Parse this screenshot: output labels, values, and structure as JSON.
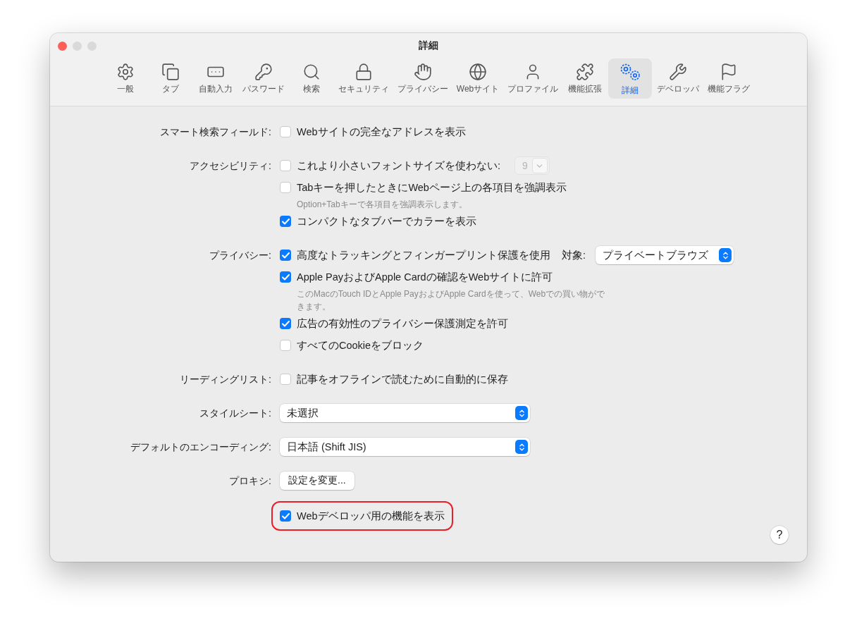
{
  "window": {
    "title": "詳細"
  },
  "tabs": [
    {
      "label": "一般",
      "selected": false
    },
    {
      "label": "タブ",
      "selected": false
    },
    {
      "label": "自動入力",
      "selected": false
    },
    {
      "label": "パスワード",
      "selected": false
    },
    {
      "label": "検索",
      "selected": false
    },
    {
      "label": "セキュリティ",
      "selected": false
    },
    {
      "label": "プライバシー",
      "selected": false
    },
    {
      "label": "Webサイト",
      "selected": false
    },
    {
      "label": "プロファイル",
      "selected": false
    },
    {
      "label": "機能拡張",
      "selected": false
    },
    {
      "label": "詳細",
      "selected": true
    },
    {
      "label": "デベロッパ",
      "selected": false
    },
    {
      "label": "機能フラグ",
      "selected": false
    }
  ],
  "sections": [
    {
      "label": "スマート検索フィールド:",
      "items": [
        {
          "kind": "checkbox",
          "label": "Webサイトの完全なアドレスを表示",
          "checked": false
        }
      ]
    },
    {
      "label": "アクセシビリティ:",
      "items": [
        {
          "kind": "checkbox",
          "label": "これより小さいフォントサイズを使わない:",
          "checked": false,
          "stepper": {
            "value": "9",
            "disabled": true
          }
        },
        {
          "kind": "checkbox",
          "label": "Tabキーを押したときにWebページ上の各項目を強調表示",
          "checked": false
        },
        {
          "kind": "note",
          "text": "Option+Tabキーで各項目を強調表示します。"
        },
        {
          "kind": "checkbox",
          "label": "コンパクトなタブバーでカラーを表示",
          "checked": true
        }
      ]
    },
    {
      "label": "プライバシー:",
      "items": [
        {
          "kind": "checkbox",
          "label": "高度なトラッキングとフィンガープリント保護を使用",
          "checked": true,
          "popup": {
            "label": "対象:",
            "value": "プライベートブラウズ"
          }
        },
        {
          "kind": "checkbox",
          "label": "Apple PayおよびApple Cardの確認をWebサイトに許可",
          "checked": true
        },
        {
          "kind": "note",
          "text": "このMacのTouch IDとApple PayおよびApple Cardを使って、Webでの買い物ができます。"
        },
        {
          "kind": "checkbox",
          "label": "広告の有効性のプライバシー保護測定を許可",
          "checked": true
        },
        {
          "kind": "checkbox",
          "label": "すべてのCookieをブロック",
          "checked": false
        }
      ]
    },
    {
      "label": "リーディングリスト:",
      "items": [
        {
          "kind": "checkbox",
          "label": "記事をオフラインで読むために自動的に保存",
          "checked": false
        }
      ]
    },
    {
      "label": "スタイルシート:",
      "items": [
        {
          "kind": "select",
          "value": "未選択"
        }
      ]
    },
    {
      "label": "デフォルトのエンコーディング:",
      "items": [
        {
          "kind": "select",
          "value": "日本語 (Shift JIS)"
        }
      ]
    },
    {
      "label": "プロキシ:",
      "items": [
        {
          "kind": "button",
          "label": "設定を変更..."
        }
      ]
    },
    {
      "items": [
        {
          "kind": "checkbox",
          "label": "Webデベロッパ用の機能を表示",
          "checked": true,
          "highlighted": true
        }
      ]
    }
  ],
  "help": "?"
}
